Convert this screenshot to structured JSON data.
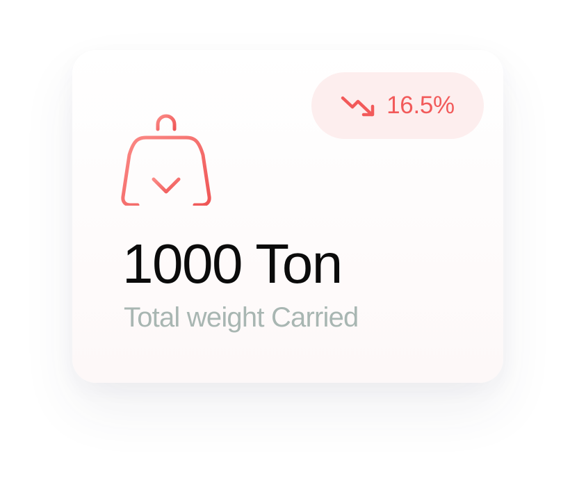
{
  "card": {
    "icon": "shopping-bag-download-icon",
    "value": "1000 Ton",
    "label": "Total weight Carried",
    "trend": {
      "icon": "trending-down-icon",
      "value": "16.5%",
      "direction": "down"
    }
  },
  "colors": {
    "accent": "#f25a5a",
    "badge_background": "#fdeeee",
    "value_text": "#0b0b0b",
    "label_text": "#a8b6b2",
    "card_background": "#ffffff"
  }
}
